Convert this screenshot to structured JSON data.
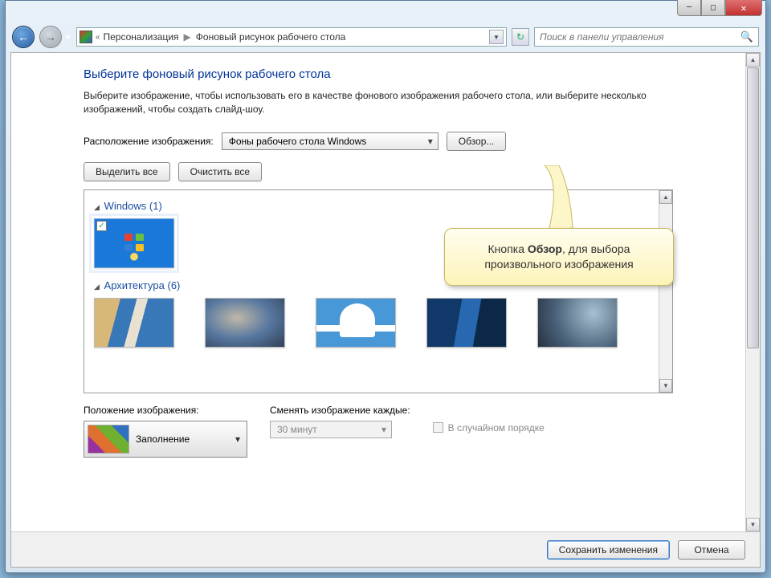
{
  "breadcrumb": {
    "parent": "Персонализация",
    "current": "Фоновый рисунок рабочего стола"
  },
  "search": {
    "placeholder": "Поиск в панели управления"
  },
  "page": {
    "title": "Выберите фоновый рисунок рабочего стола",
    "description": "Выберите изображение, чтобы использовать его в качестве фонового изображения рабочего стола, или выберите несколько изображений, чтобы создать слайд-шоу."
  },
  "location": {
    "label": "Расположение изображения:",
    "value": "Фоны рабочего стола Windows",
    "browse": "Обзор..."
  },
  "buttons": {
    "select_all": "Выделить все",
    "clear_all": "Очистить все",
    "save": "Сохранить изменения",
    "cancel": "Отмена"
  },
  "groups": {
    "windows": {
      "name": "Windows",
      "count": "(1)"
    },
    "arch": {
      "name": "Архитектура",
      "count": "(6)"
    }
  },
  "position": {
    "label": "Положение изображения:",
    "value": "Заполнение"
  },
  "interval": {
    "label": "Сменять изображение каждые:",
    "value": "30 минут"
  },
  "shuffle": {
    "label": "В случайном порядке"
  },
  "callout": {
    "prefix": "Кнопка ",
    "bold": "Обзор",
    "suffix": ", для выбора произвольного изображения"
  }
}
